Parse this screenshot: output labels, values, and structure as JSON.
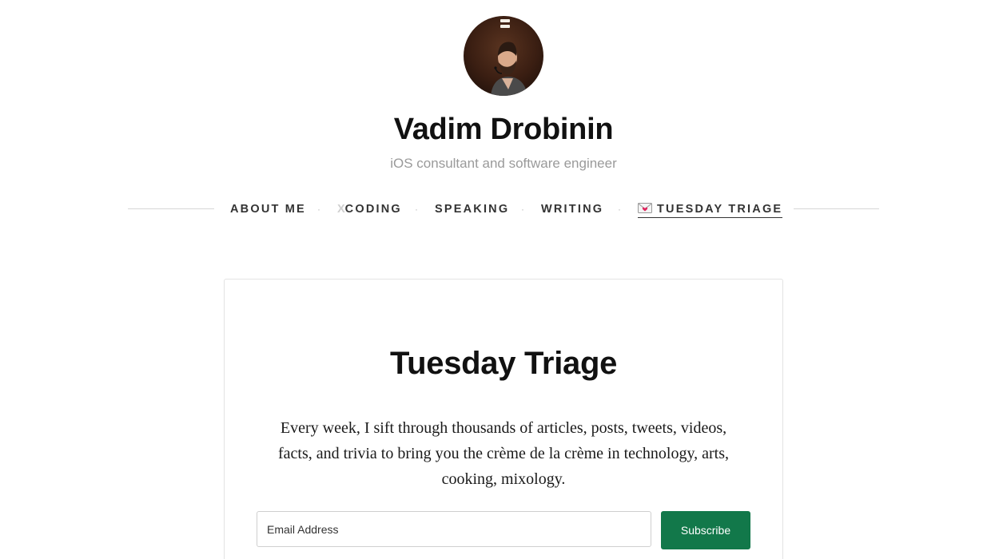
{
  "header": {
    "avatar_icon": "portrait-photo",
    "name": "Vadim Drobinin",
    "tagline": "iOS consultant and software engineer"
  },
  "nav": {
    "items": [
      {
        "label": "ABOUT ME"
      },
      {
        "prefix": "X",
        "label": "CODING"
      },
      {
        "label": "SPEAKING"
      },
      {
        "label": "WRITING"
      },
      {
        "icon": "envelope-heart-icon",
        "label": "TUESDAY TRIAGE",
        "active": true
      }
    ],
    "separator": "·"
  },
  "newsletter": {
    "title": "Tuesday Triage",
    "description": "Every week, I sift through thousands of articles, posts, tweets, videos, facts, and trivia to bring you the crème de la crème in technology, arts, cooking, mixology.",
    "email_placeholder": "Email Address",
    "subscribe_label": "Subscribe"
  },
  "colors": {
    "accent": "#12784a",
    "tagline": "#9a9a9a",
    "nav_text": "#333333"
  }
}
